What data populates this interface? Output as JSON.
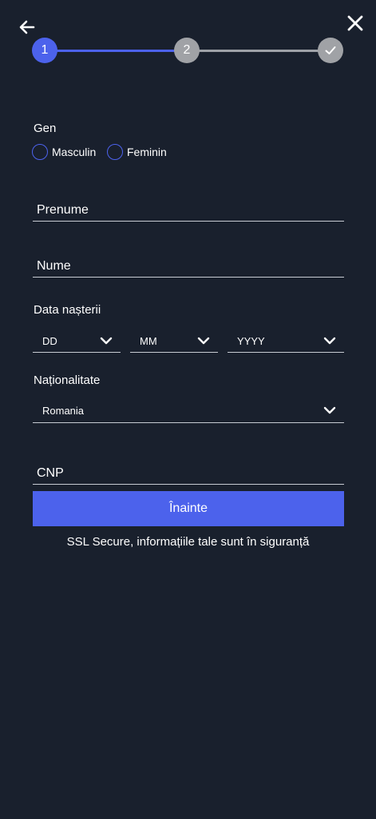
{
  "nav": {
    "back_icon": "arrow-left-icon",
    "close_icon": "close-icon"
  },
  "stepper": {
    "steps": [
      {
        "label": "1",
        "state": "active",
        "color": "#4c62ec"
      },
      {
        "label": "2",
        "state": "pending",
        "color": "#a0a2a6"
      },
      {
        "icon": "checkmark-icon",
        "state": "pending",
        "color": "#a0a2a6"
      }
    ],
    "active_line_color": "#4c62ec",
    "inactive_line_color": "#9ea1a7"
  },
  "gender": {
    "label": "Gen",
    "options": [
      "Masculin",
      "Feminin"
    ]
  },
  "first_name": {
    "placeholder": "Prenume"
  },
  "last_name": {
    "placeholder": "Nume"
  },
  "birth_date": {
    "label": "Data nașterii",
    "day": "DD",
    "month": "MM",
    "year": "YYYY"
  },
  "nationality": {
    "label": "Naționalitate",
    "value": "Romania"
  },
  "cnp": {
    "placeholder": "CNP"
  },
  "submit_label": "Înainte",
  "secure_text": "SSL Secure, informațiile tale sunt în siguranță",
  "colors": {
    "background": "#19202d",
    "accent": "#4c62ec",
    "text": "#ffffff"
  }
}
